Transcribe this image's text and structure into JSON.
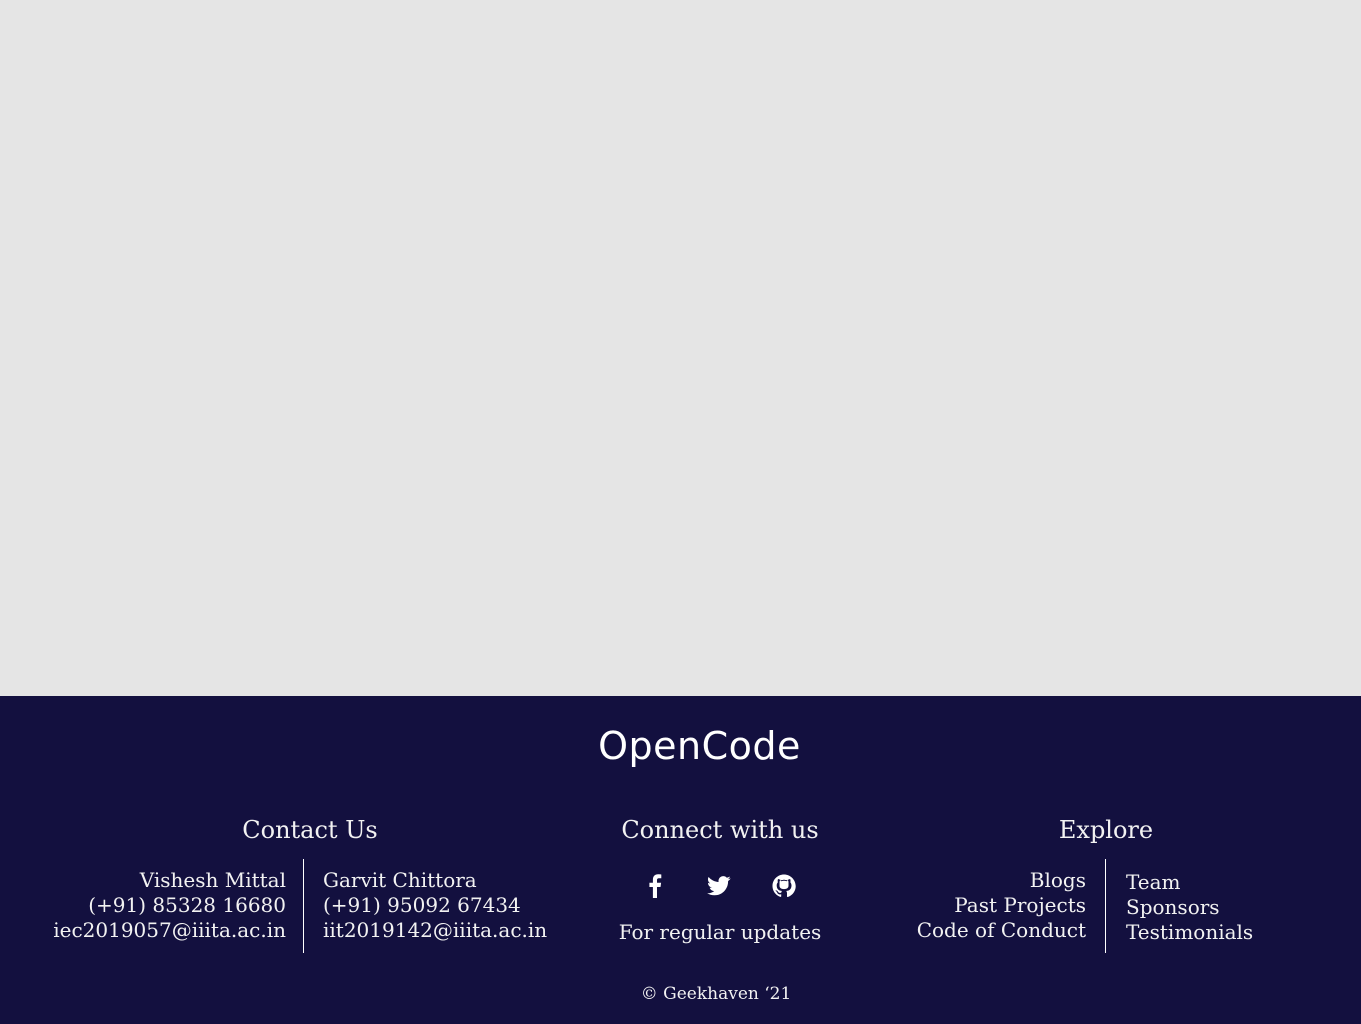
{
  "footer": {
    "brand": "OpenCode",
    "contact": {
      "heading": "Contact Us",
      "people": [
        {
          "name": "Vishesh Mittal",
          "phone": "(+91) 85328 16680",
          "email": "iec2019057@iiita.ac.in"
        },
        {
          "name": "Garvit Chittora",
          "phone": "(+91) 95092 67434",
          "email": "iit2019142@iiita.ac.in"
        }
      ]
    },
    "connect": {
      "heading": "Connect with us",
      "icons": [
        "facebook-icon",
        "twitter-icon",
        "github-icon"
      ],
      "tagline": "For regular updates"
    },
    "explore": {
      "heading": "Explore",
      "left_links": [
        "Blogs",
        "Past Projects",
        "Code of Conduct"
      ],
      "right_links": [
        "Team",
        "Sponsors",
        "Testimonials"
      ]
    },
    "copyright": "© Geekhaven ‘21"
  },
  "colors": {
    "content_background": "#e5e5e5",
    "footer_background": "#13103f",
    "footer_text": "#ffffff"
  }
}
